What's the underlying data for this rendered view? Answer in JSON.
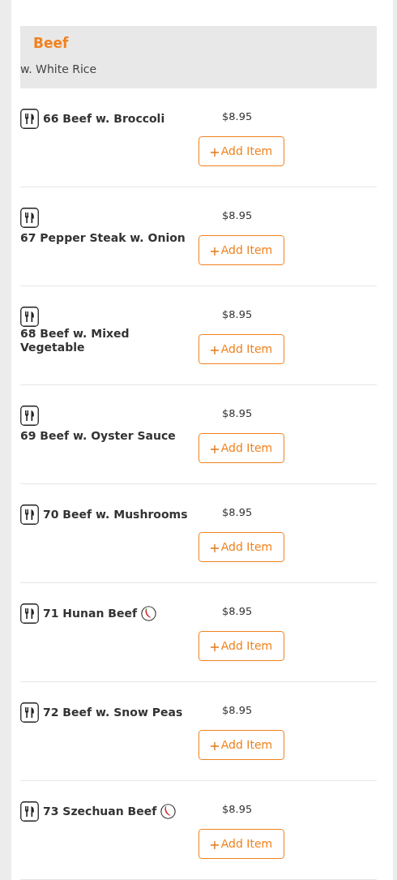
{
  "category": {
    "title": "Beef",
    "subtitle": "w. White Rice"
  },
  "items": [
    {
      "name": "66 Beef w. Broccoli",
      "spicy": false,
      "price": "$8.95",
      "button": "Add Item"
    },
    {
      "name": "67 Pepper Steak w. Onion",
      "spicy": false,
      "price": "$8.95",
      "button": "Add Item"
    },
    {
      "name": "68 Beef w. Mixed Vegetable",
      "spicy": false,
      "price": "$8.95",
      "button": "Add Item"
    },
    {
      "name": "69 Beef w. Oyster Sauce",
      "spicy": false,
      "price": "$8.95",
      "button": "Add Item"
    },
    {
      "name": "70 Beef w. Mushrooms",
      "spicy": false,
      "price": "$8.95",
      "button": "Add Item"
    },
    {
      "name": "71 Hunan Beef",
      "spicy": true,
      "price": "$8.95",
      "button": "Add Item"
    },
    {
      "name": "72 Beef w. Snow Peas",
      "spicy": false,
      "price": "$8.95",
      "button": "Add Item"
    },
    {
      "name": "73 Szechuan Beef",
      "spicy": true,
      "price": "$8.95",
      "button": "Add Item"
    }
  ]
}
